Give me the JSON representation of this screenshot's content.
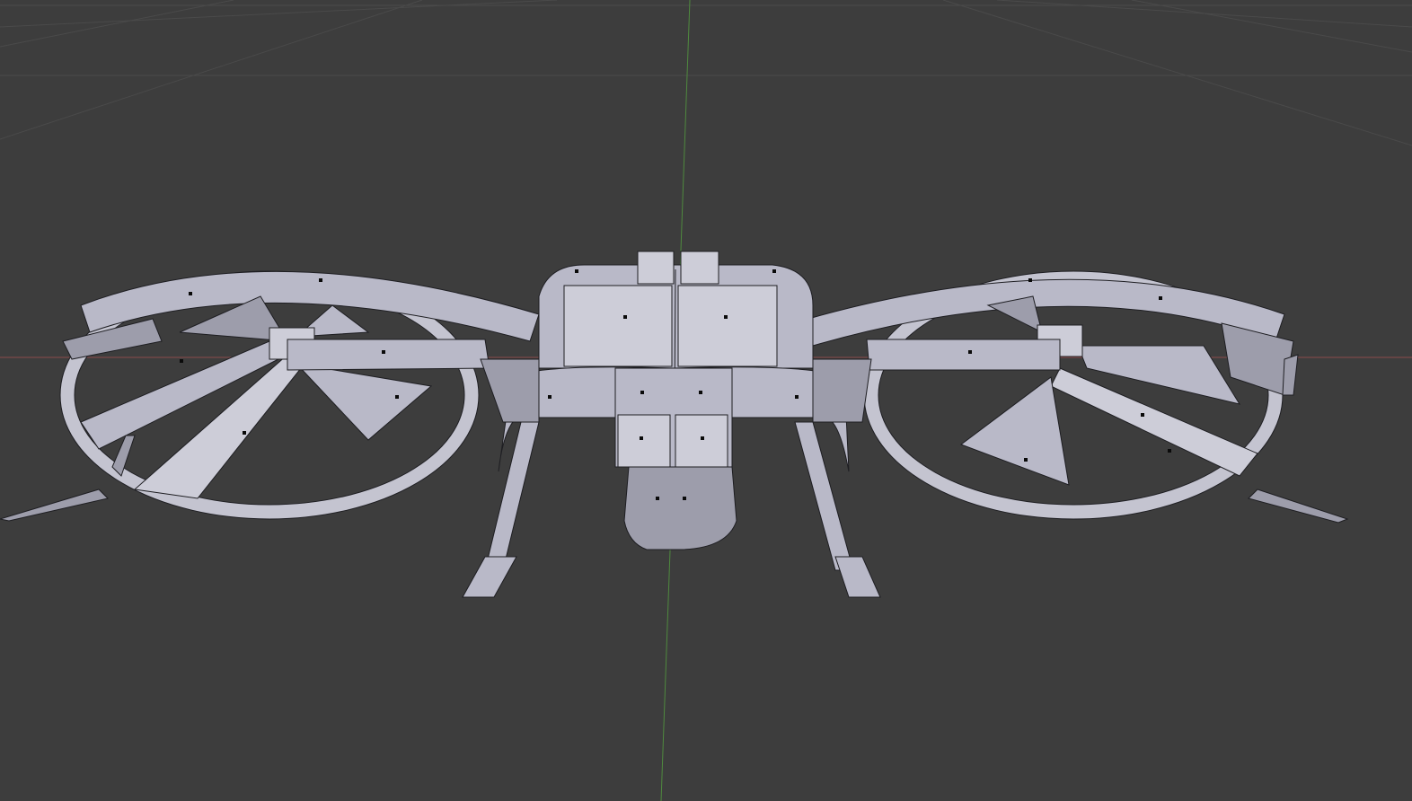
{
  "viewport": {
    "background": "#3d3d3d",
    "grid_color": "#4a4a4a",
    "x_axis_color": "#8a4a4a",
    "y_axis_color": "#4f8a3e",
    "mesh_color": "#b9b9c8",
    "wire_color": "#1e1e22",
    "object": "drone-mesh"
  }
}
